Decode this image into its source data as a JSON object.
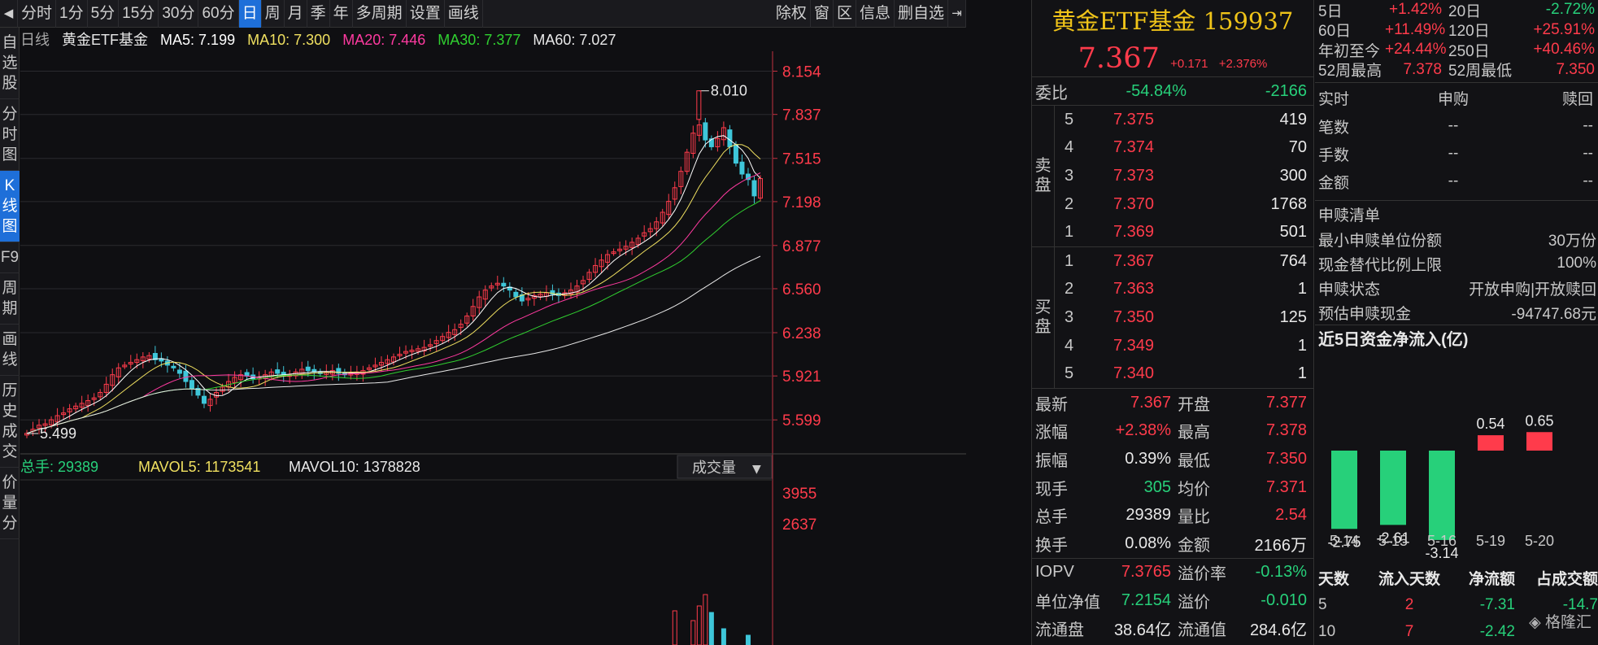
{
  "toolbar": {
    "back_icon": "◀",
    "periods": [
      "分时",
      "1分",
      "5分",
      "15分",
      "30分",
      "60分",
      "日",
      "周",
      "月",
      "季",
      "年",
      "多周期",
      "设置",
      "画线"
    ],
    "active_period": "日",
    "right_items": [
      "除权",
      "窗",
      "区",
      "信息",
      "删自选"
    ],
    "exit_icon": "⇥"
  },
  "sidenav": [
    {
      "label": "自选股",
      "active": false
    },
    {
      "label": "分时图",
      "active": false
    },
    {
      "label": "K线图",
      "active": true
    },
    {
      "label": "F9",
      "active": false
    },
    {
      "label": "周期",
      "active": false
    },
    {
      "label": "画线",
      "active": false
    },
    {
      "label": "历史成交",
      "active": false
    },
    {
      "label": "价量分",
      "active": false
    }
  ],
  "ma_bar": {
    "period": "日线",
    "name": "黄金ETF基金",
    "ma5": "MA5: 7.199",
    "ma10": "MA10: 7.300",
    "ma20": "MA20: 7.446",
    "ma30": "MA30: 7.377",
    "ma60": "MA60: 7.027"
  },
  "colors": {
    "up": "#ff3b4b",
    "down": "#3ec6d9",
    "ma5": "#ffffff",
    "ma10": "#f0e060",
    "ma20": "#ff3aa0",
    "ma30": "#30d030",
    "ma60": "#e8e8e8",
    "axis_text": "#ff3b4b",
    "grid": "#2a2a2e"
  },
  "chart_data": {
    "type": "candlestick",
    "y_ticks": [
      "8.154",
      "7.837",
      "7.515",
      "7.198",
      "6.877",
      "6.560",
      "6.238",
      "5.921",
      "5.599"
    ],
    "ylim": [
      5.35,
      8.3
    ],
    "high_label": "8.010",
    "low_label": "5.499",
    "closes": [
      5.5,
      5.53,
      5.56,
      5.57,
      5.6,
      5.63,
      5.65,
      5.68,
      5.7,
      5.72,
      5.74,
      5.76,
      5.8,
      5.86,
      5.93,
      5.98,
      6.0,
      6.02,
      6.04,
      6.06,
      6.07,
      6.04,
      6.03,
      6.0,
      5.98,
      5.94,
      5.88,
      5.83,
      5.78,
      5.72,
      5.75,
      5.8,
      5.84,
      5.88,
      5.91,
      5.93,
      5.92,
      5.9,
      5.91,
      5.93,
      5.95,
      5.94,
      5.92,
      5.93,
      5.95,
      5.97,
      5.96,
      5.95,
      5.94,
      5.95,
      5.96,
      5.94,
      5.93,
      5.94,
      5.95,
      5.96,
      5.98,
      6.0,
      6.02,
      6.04,
      6.06,
      6.08,
      6.1,
      6.11,
      6.12,
      6.13,
      6.15,
      6.18,
      6.21,
      6.24,
      6.26,
      6.3,
      6.36,
      6.43,
      6.5,
      6.55,
      6.58,
      6.6,
      6.58,
      6.55,
      6.5,
      6.47,
      6.49,
      6.51,
      6.52,
      6.53,
      6.52,
      6.51,
      6.53,
      6.55,
      6.58,
      6.62,
      6.68,
      6.73,
      6.77,
      6.81,
      6.83,
      6.85,
      6.87,
      6.9,
      6.93,
      6.97,
      7.0,
      7.05,
      7.12,
      7.2,
      7.3,
      7.42,
      7.56,
      7.7,
      7.76,
      7.65,
      7.6,
      7.66,
      7.74,
      7.6,
      7.48,
      7.4,
      7.36,
      7.24,
      7.367
    ],
    "volume_panel": {
      "label_total": "总手: 29389",
      "label_mavol5": "MAVOL5: 1173541",
      "label_mavol10": "MAVOL10: 1378828",
      "selector": "成交量",
      "y_ticks": [
        "3955",
        "2637"
      ]
    }
  },
  "quote": {
    "title": "黄金ETF基金 159937",
    "price": "7.367",
    "change": "+0.171",
    "change_pct": "+2.376%",
    "weibi": {
      "label": "委比",
      "pct": "-54.84%",
      "diff": "-2166"
    },
    "sell_label": "卖盘",
    "buy_label": "买盘",
    "sell": [
      {
        "level": "5",
        "price": "7.375",
        "vol": "419"
      },
      {
        "level": "4",
        "price": "7.374",
        "vol": "70"
      },
      {
        "level": "3",
        "price": "7.373",
        "vol": "300"
      },
      {
        "level": "2",
        "price": "7.370",
        "vol": "1768"
      },
      {
        "level": "1",
        "price": "7.369",
        "vol": "501"
      }
    ],
    "buy": [
      {
        "level": "1",
        "price": "7.367",
        "vol": "764"
      },
      {
        "level": "2",
        "price": "7.363",
        "vol": "1"
      },
      {
        "level": "3",
        "price": "7.350",
        "vol": "125"
      },
      {
        "level": "4",
        "price": "7.349",
        "vol": "1"
      },
      {
        "level": "5",
        "price": "7.340",
        "vol": "1"
      }
    ],
    "stats": [
      {
        "k": "最新",
        "v": "7.367",
        "vc": "red",
        "k2": "开盘",
        "v2": "7.377",
        "v2c": "red"
      },
      {
        "k": "涨幅",
        "v": "+2.38%",
        "vc": "red",
        "k2": "最高",
        "v2": "7.378",
        "v2c": "red"
      },
      {
        "k": "振幅",
        "v": "0.39%",
        "vc": "white",
        "k2": "最低",
        "v2": "7.350",
        "v2c": "red"
      },
      {
        "k": "现手",
        "v": "305",
        "vc": "green",
        "k2": "均价",
        "v2": "7.371",
        "v2c": "red"
      },
      {
        "k": "总手",
        "v": "29389",
        "vc": "white",
        "k2": "量比",
        "v2": "2.54",
        "v2c": "red"
      },
      {
        "k": "换手",
        "v": "0.08%",
        "vc": "white",
        "k2": "金额",
        "v2": "2166万",
        "v2c": "white"
      }
    ],
    "stats2": [
      {
        "k": "IOPV",
        "v": "7.3765",
        "vc": "red",
        "k2": "溢价率",
        "v2": "-0.13%",
        "v2c": "green"
      },
      {
        "k": "单位净值",
        "v": "7.2154",
        "vc": "green",
        "k2": "溢价",
        "v2": "-0.010",
        "v2c": "green"
      },
      {
        "k": "流通盘",
        "v": "38.64亿",
        "vc": "white",
        "k2": "流通值",
        "v2": "284.6亿",
        "v2c": "white"
      }
    ]
  },
  "returns": [
    {
      "k": "5日",
      "v": "+1.42%",
      "vc": "red",
      "k2": "20日",
      "v2": "-2.72%",
      "v2c": "green"
    },
    {
      "k": "60日",
      "v": "+11.49%",
      "vc": "red",
      "k2": "120日",
      "v2": "+25.91%",
      "v2c": "red"
    },
    {
      "k": "年初至今",
      "v": "+24.44%",
      "vc": "red",
      "k2": "250日",
      "v2": "+40.46%",
      "v2c": "red"
    },
    {
      "k": "52周最高",
      "v": "7.378",
      "vc": "red",
      "k2": "52周最低",
      "v2": "7.350",
      "v2c": "red"
    }
  ],
  "subscription": {
    "header": [
      "实时",
      "申购",
      "赎回"
    ],
    "rows": [
      {
        "k": "笔数",
        "a": "--",
        "b": "--"
      },
      {
        "k": "手数",
        "a": "--",
        "b": "--"
      },
      {
        "k": "金额",
        "a": "--",
        "b": "--"
      }
    ]
  },
  "sub_list": {
    "title": "申赎清单",
    "rows": [
      {
        "k": "最小申赎单位份额",
        "v": "30万份"
      },
      {
        "k": "现金替代比例上限",
        "v": "100%"
      },
      {
        "k": "申赎状态",
        "v": "开放申购|开放赎回"
      },
      {
        "k": "预估申赎现金",
        "v": "-94747.68元"
      }
    ]
  },
  "flow": {
    "title": "近5日资金净流入(亿)",
    "chart_data": {
      "type": "bar",
      "categories": [
        "5-14",
        "5-15",
        "5-16",
        "5-19",
        "5-20"
      ],
      "values": [
        -2.75,
        -2.61,
        -3.14,
        0.54,
        0.65
      ]
    },
    "table_header": [
      "天数",
      "流入天数",
      "净流额",
      "占成交额"
    ],
    "table_rows": [
      {
        "days": "5",
        "in_days": "2",
        "net": "-7.31",
        "pct": "-14.7"
      },
      {
        "days": "10",
        "in_days": "7",
        "net": "-2.42",
        "pct": ""
      }
    ],
    "watermark": "格隆汇"
  }
}
